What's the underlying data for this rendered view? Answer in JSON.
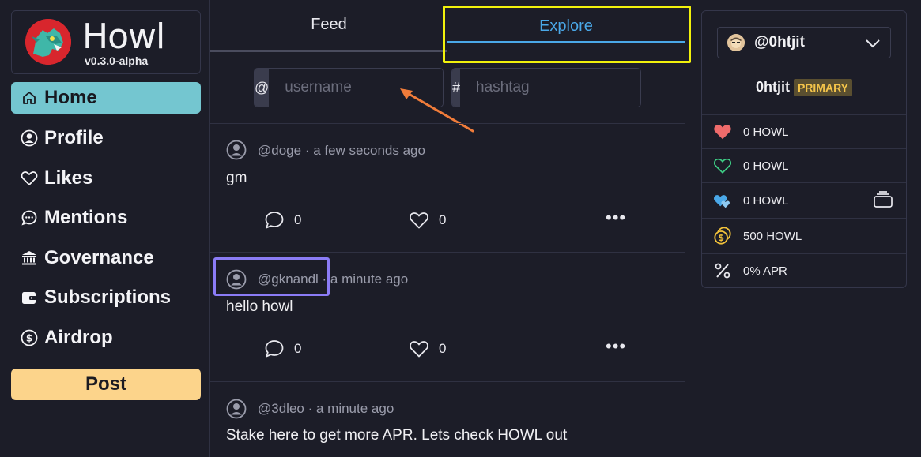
{
  "app": {
    "name": "Howl",
    "version": "v0.3.0-alpha"
  },
  "sidebar": {
    "items": [
      {
        "label": "Home",
        "icon": "home-icon",
        "active": true
      },
      {
        "label": "Profile",
        "icon": "user-circle-icon"
      },
      {
        "label": "Likes",
        "icon": "heart-icon"
      },
      {
        "label": "Mentions",
        "icon": "chat-bubble-icon"
      },
      {
        "label": "Governance",
        "icon": "bank-icon"
      },
      {
        "label": "Subscriptions",
        "icon": "wallet-icon"
      },
      {
        "label": "Airdrop",
        "icon": "dollar-coin-icon"
      }
    ],
    "post_label": "Post"
  },
  "tabs": [
    {
      "label": "Feed",
      "active": false
    },
    {
      "label": "Explore",
      "active": true
    }
  ],
  "search": {
    "username_prefix": "@",
    "username_placeholder": "username",
    "hashtag_prefix": "#",
    "hashtag_placeholder": "hashtag"
  },
  "posts": [
    {
      "handle": "@doge",
      "time": "· a few seconds ago",
      "body": "gm",
      "comments": "0",
      "likes": "0"
    },
    {
      "handle": "@gknandl",
      "time": "· a minute ago",
      "body": "hello howl",
      "comments": "0",
      "likes": "0"
    },
    {
      "handle": "@3dleo",
      "time": "· a minute ago",
      "body": "Stake here to get more APR. Lets check HOWL out"
    }
  ],
  "wallet": {
    "account_handle": "@0htjit",
    "account_name": "0htjit",
    "badge": "PRIMARY",
    "rows": [
      {
        "icon": "heart-filled-icon",
        "value": "0 HOWL",
        "color": "#ef6b6b"
      },
      {
        "icon": "heart-outline-icon",
        "value": "0 HOWL",
        "color": "#3ecf86"
      },
      {
        "icon": "hearts-icon",
        "value": "0 HOWL",
        "color": "#4aa8e8"
      },
      {
        "icon": "coins-icon",
        "value": "500 HOWL",
        "color": "#f2c23a"
      },
      {
        "icon": "percent-icon",
        "value": "0% APR"
      }
    ]
  },
  "colors": {
    "background": "#1c1d28",
    "active_nav": "#74c6d0",
    "post_button": "#fcd48b",
    "explore_accent": "#4aa8e8",
    "highlight_yellow": "#f1f10c",
    "highlight_purple": "#8b7cf6",
    "arrow": "#f07c3a"
  }
}
